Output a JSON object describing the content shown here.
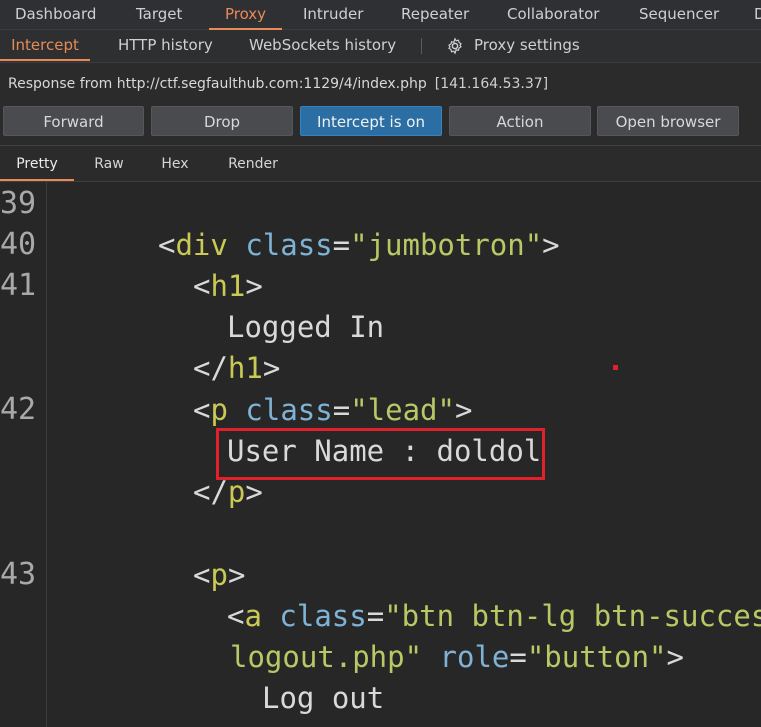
{
  "top_tabs": [
    "Dashboard",
    "Target",
    "Proxy",
    "Intruder",
    "Repeater",
    "Collaborator",
    "Sequencer",
    "D"
  ],
  "sub_tabs": [
    "Intercept",
    "HTTP history",
    "WebSockets history"
  ],
  "proxy_settings_label": "Proxy settings",
  "response": {
    "text": "Response from http://ctf.segfaulthub.com:1129/4/index.php",
    "ip": "[141.164.53.37]"
  },
  "buttons": {
    "forward": "Forward",
    "drop": "Drop",
    "intercept": "Intercept is on",
    "action": "Action",
    "open_browser": "Open browser"
  },
  "view_tabs": [
    "Pretty",
    "Raw",
    "Hex",
    "Render"
  ],
  "line_numbers": [
    "39",
    "40",
    "41",
    "42",
    "43"
  ],
  "code": {
    "l40_tag": "div",
    "l40_attr": "class",
    "l40_val": "\"jumbotron\"",
    "l41_tag": "h1",
    "l41_text": "Logged In",
    "l41_close": "h1",
    "l42_tag": "p",
    "l42_attr": "class",
    "l42_val": "\"lead\"",
    "l42_text": "User Name : doldol",
    "l42_close": "p",
    "l43_tag": "p",
    "a_tag": "a",
    "a_attr": "class",
    "a_val": "\"btn btn-lg btn-succes",
    "a_href": "logout.php\"",
    "a_role_attr": "role",
    "a_role_val": "\"button\"",
    "a_text": "Log out"
  },
  "colors": {
    "accent": "#e98a58",
    "intercept_on": "#2a6ea3",
    "highlight_box": "#e0202a"
  }
}
